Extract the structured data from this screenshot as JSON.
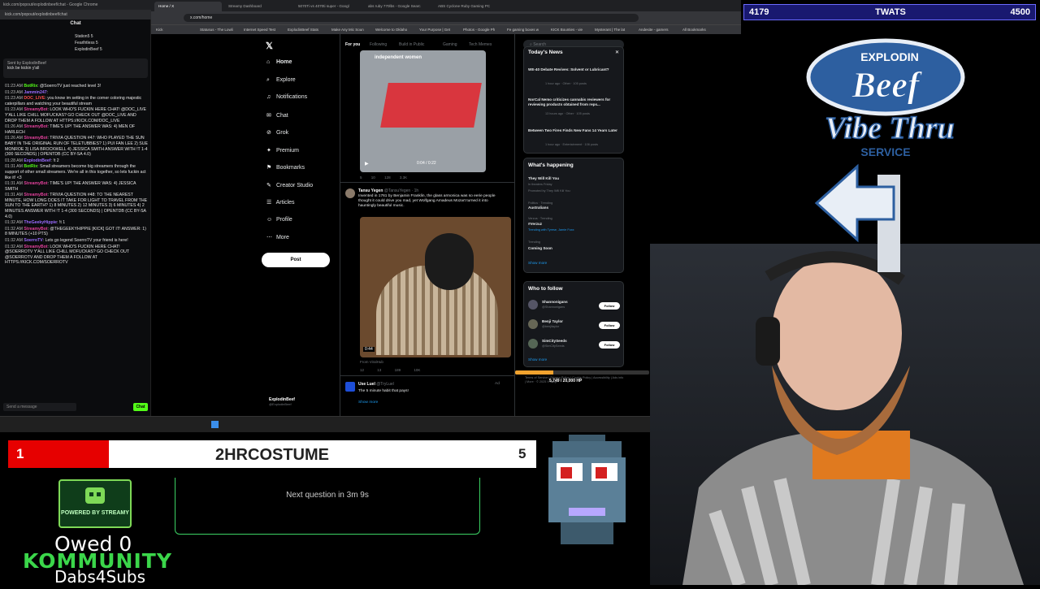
{
  "chat_window": {
    "title_bar": "kick.com/popout/explodinbeef/chat - Google Chrome",
    "url": "kick.com/popout/explodinbeef/chat",
    "header": "Chat",
    "viewers": [
      {
        "name": "Station5",
        "badge": "5"
      },
      {
        "name": "Fearlhtless",
        "badge": "5"
      },
      {
        "name": "ExplodinBeef",
        "badge": "5"
      }
    ],
    "pinned": {
      "sender": "Sent by ExplodinBeef",
      "text": "kick be kickin y'all"
    },
    "messages": [
      {
        "time": "01:23 AM",
        "user": "BotRix",
        "text": "@SoerroTV just reached level 3!"
      },
      {
        "time": "01:23 AM",
        "user": "Jammin247",
        "text": ""
      },
      {
        "time": "01:23 AM",
        "user": "DOC_LIVE",
        "text": "you know im setting in the corner coloring majestic caterpillars and watching your beautiful stream"
      },
      {
        "time": "01:23 AM",
        "user": "StreamyBot",
        "text": "LOOK WHO'S FUCKIN HERE CHAT! @DOC_LIVE Y'ALL LIKE CHILL MOFUCKAS? GO CHECK OUT @DOC_LIVE AND DROP THEM A FOLLOW AT HTTPS://KICK.COM/DOC_LIVE"
      },
      {
        "time": "01:26 AM",
        "user": "StreamyBot",
        "text": "TIME'S UP! THE ANSWER WAS: 4) MEN OF HARLECH"
      },
      {
        "time": "01:26 AM",
        "user": "StreamyBot",
        "text": "TRIVIA QUESTION #47: WHO PLAYED THE SUN BABY IN THE ORIGINAL RUN OF TELETUBBIES? 1) PUI FAN LEE 2) SUE MONROE 3) LISA BROCKWELL 4) JESSICA SMITH ANSWER WITH !T 1-4 (300 SECONDS) | OPENTDB (CC BY-SA 4.0)"
      },
      {
        "time": "01:28 AM",
        "user": "ExplodinBeef",
        "text": "!t 2"
      },
      {
        "time": "01:31 AM",
        "user": "BotRix",
        "text": "Small streamers become big streamers through the support of other small streamers. We're all in this together, so lets fuckin act like it! <3"
      },
      {
        "time": "01:31 AM",
        "user": "StreamyBot",
        "text": "TIME'S UP! THE ANSWER WAS: 4) JESSICA SMITH"
      },
      {
        "time": "01:31 AM",
        "user": "StreamyBot",
        "text": "TRIVIA QUESTION #48: TO THE NEAREST MINUTE, HOW LONG DOES IT TAKE FOR LIGHT TO TRAVEL FROM THE SUN TO THE EARTH? 1) 8 MINUTES 2) 12 MINUTES 3) 6 MINUTES 4) 2 MINUTES ANSWER WITH !T 1-4 (300 SECONDS) | OPENTDB (CC BY-SA 4.0)"
      },
      {
        "time": "01:32 AM",
        "user": "TheGeekyHippie",
        "text": "!t 1"
      },
      {
        "time": "01:32 AM",
        "user": "StreamyBot",
        "text": "@THEGEEKYHIPPIE [KICK] GOT IT! ANSWER: 1) 8 MINUTES (+10 PTS)"
      },
      {
        "time": "01:32 AM",
        "user": "SoerroTV",
        "text": "Lets go legend SoerroTV your friend is here!"
      },
      {
        "time": "01:32 AM",
        "user": "StreamyBot",
        "text": "LOOK WHO'S FUCKIN HERE CHAT! @SOERROTV Y'ALL LIKE CHILL MOFUCKAS? GO CHECK OUT @SOERROTV AND DROP THEM A FOLLOW AT HTTPS://KICK.COM/SOERROTV"
      }
    ],
    "input_placeholder": "Send a message",
    "send_label": "Chat"
  },
  "browser": {
    "tabs": [
      {
        "label": "Home / X"
      },
      {
        "label": "Streamy Dashboard"
      },
      {
        "label": "5070Ti vs 4070ti super - Googl"
      },
      {
        "label": "abs ruby 770lbs - Google Searc"
      },
      {
        "label": "ABS Cyclone Ruby Gaming PC"
      }
    ],
    "active_tab": 0,
    "url": "x.com/home",
    "bookmarks": [
      "Kick",
      "Statusus - The Lowli",
      "Internet Speed Test",
      "ExplodinBeef Stats",
      "Make Any Mic Soun",
      "Welcome to Oklaho",
      "Your Purpose | Get",
      "Photos - Google Ph",
      "Fe gaming boxes w",
      "KICK Bounties - vie",
      "Mysterant | The lat",
      "Andesite - gamers",
      "All Bookmarks"
    ]
  },
  "x": {
    "nav": [
      "Home",
      "Explore",
      "Notifications",
      "Chat",
      "Grok",
      "Premium",
      "Bookmarks",
      "Creator Studio",
      "Articles",
      "Profile",
      "More"
    ],
    "nav_icons": [
      "home-icon",
      "search-icon",
      "bell-icon",
      "chat-icon",
      "grok-icon",
      "premium-icon",
      "bookmark-icon",
      "creator-studio-icon",
      "articles-icon",
      "profile-icon",
      "more-icon"
    ],
    "post_label": "Post",
    "profile_name": "ExplodinBeef",
    "profile_handle": "@ExplodinBeef",
    "feed_tabs": [
      "For you",
      "Following",
      "Build in Public",
      "Gaming",
      "Tech Memes"
    ],
    "tweet1": {
      "overlay": "independent women",
      "video_time": "0:04 / 0:22",
      "counts": [
        "5",
        "10",
        "128",
        "3.3K"
      ]
    },
    "tweet2": {
      "name": "Tansu Yegen",
      "handle": "@TansuYegen · 1h",
      "text": "Invented in 1761 by Benjamin Franklin, the glass armonica was so eerie people thought it could drive you mad, yet Wolfgang Amadeus Mozart turned it into hauntingly beautiful music.",
      "video_time": "0:44",
      "from": "From ViralHub",
      "counts": [
        "12",
        "13",
        "189",
        "10K"
      ]
    },
    "tweet3": {
      "name": "Use Luel",
      "handle": "@TryLuel",
      "text": "The 5 minute habit that pays!",
      "ad": "Ad",
      "more": "Show more"
    },
    "search_placeholder": "Search",
    "todays_news": {
      "title": "Today's News",
      "items": [
        {
          "text": "WE-40 Debate Revives: Solvent or Lubricant?",
          "meta": "1 hour ago · Other · 105 posts"
        },
        {
          "text": "NorCal Nemo criticizes cannabis reviewers for reviewing products obtained from reps...",
          "meta": "13 hours ago · Other · 105 posts"
        },
        {
          "text": "Between Two Fires Finds New Fans 14 Years Later",
          "meta": "1 hour ago · Entertainment · 106 posts"
        }
      ]
    },
    "whats_happening": {
      "title": "What's happening",
      "items": [
        {
          "context": "",
          "text": "They Will Kill You",
          "meta": "In theaters Friday"
        },
        {
          "context": "Promoted by They Will Kill You",
          "text": "",
          "meta": ""
        },
        {
          "context": "Politics · Trending",
          "text": "Australians",
          "meta": ""
        },
        {
          "context": "Verzus · Trending",
          "text": "#Verzuz",
          "meta": "Trending with Tyrese, Jamie Foxx"
        },
        {
          "context": "Trending",
          "text": "Coming Soon",
          "meta": ""
        }
      ],
      "show_more": "Show more"
    },
    "who_to_follow": {
      "title": "Who to follow",
      "items": [
        {
          "name": "Shannonigans",
          "handle": "@Shannonigans"
        },
        {
          "name": "Benji Taylor",
          "handle": "@benjitaylor"
        },
        {
          "name": "SimCitySeeds",
          "handle": "@SimCitySeeds"
        }
      ],
      "follow_label": "Follow",
      "show_more": "Show more"
    },
    "footer": "Terms of Service | Privacy Policy | Cookie Policy | Accessibility | Ads info | More · © 2025 X Corp."
  },
  "hp": {
    "text": "5,749 / 20,000 HP",
    "value": 5749,
    "max": 20000
  },
  "scoreboard": {
    "left": "4179",
    "center": "TWATS",
    "right": "4500"
  },
  "logo": {
    "word1": "EXPLODIN",
    "word2": "Beef",
    "line2": "Vibe Thru",
    "line3": "SERVICE"
  },
  "question_bar": {
    "left_number": "1",
    "word": "2HRCOSTUME",
    "right_number": "5",
    "fill": 0.19
  },
  "next_question": "Next question in 3m 9s",
  "streamy_badge": "POWERED BY STREAMY",
  "owed": "Owed 0",
  "kommunity": "KOMMUNITY",
  "dabs": "Dabs4Subs",
  "colors": {
    "accent_green": "#53fc18",
    "x_black": "#000000",
    "score_bg": "#191970",
    "question_red": "#e60000"
  }
}
